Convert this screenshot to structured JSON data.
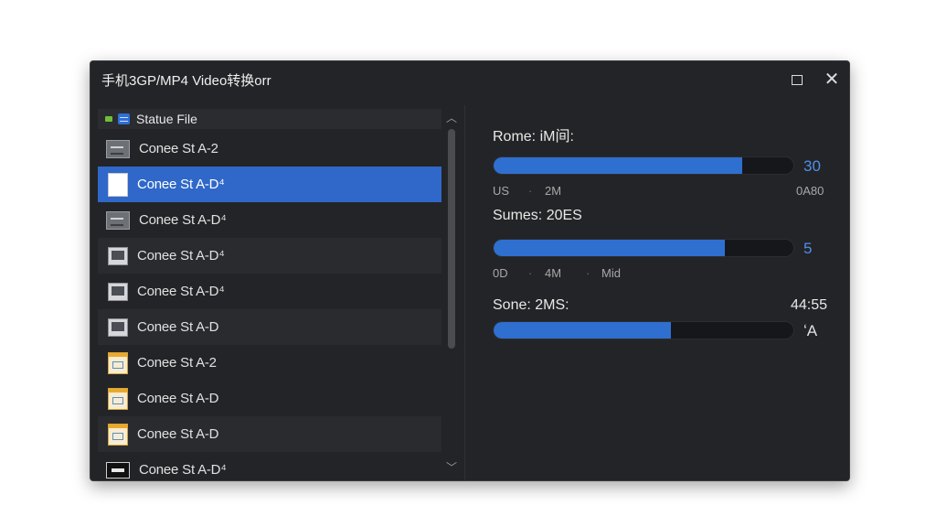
{
  "window": {
    "title": "手机3GP/MP4 Video转换orr"
  },
  "list": {
    "header": "Statue File",
    "items": [
      {
        "label": "Conee St A-2",
        "icon": "gray"
      },
      {
        "label": "Conee St A-D⁴",
        "icon": "white",
        "selected": true
      },
      {
        "label": "Conee St A-D⁴",
        "icon": "gray"
      },
      {
        "label": "Conee St A-D⁴",
        "icon": "monitor"
      },
      {
        "label": "Conee St A-D⁴",
        "icon": "monitor"
      },
      {
        "label": "Conee St A-D",
        "icon": "monitor"
      },
      {
        "label": "Conee St A-2",
        "icon": "doc"
      },
      {
        "label": "Conee St A-D",
        "icon": "doc"
      },
      {
        "label": "Conee St A-D",
        "icon": "doc"
      },
      {
        "label": "Conee St A-D⁴",
        "icon": "film"
      }
    ]
  },
  "bars": [
    {
      "label": "Rome: iM间:",
      "fill_fraction": 0.83,
      "value": "30",
      "ticks": [
        "US",
        "2M"
      ],
      "tick_right": "0A80"
    },
    {
      "label": "Sumes: 20ES",
      "fill_fraction": 0.77,
      "value": "5",
      "ticks": [
        "0D",
        "4M",
        "Mid"
      ]
    },
    {
      "label": "Sone: 2MS:",
      "right_label": "44:55",
      "fill_fraction": 0.59,
      "value": "ʻA"
    }
  ],
  "colors": {
    "accent": "#2f68c9",
    "window_bg": "#232427",
    "bar_fill": "#2f6fd0"
  }
}
